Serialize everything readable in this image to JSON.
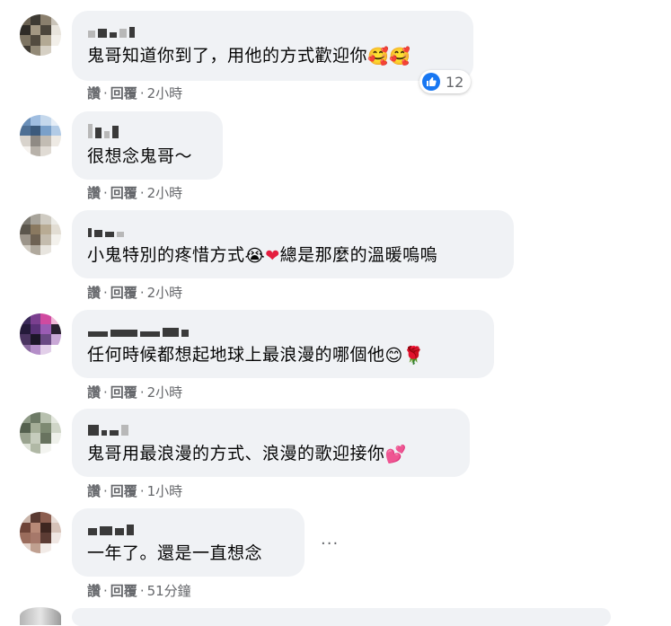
{
  "comments": [
    {
      "text": "鬼哥知道你到了，用他的方式歡迎你",
      "emoji": [
        "smiling-face-with-hearts",
        "smiling-face-with-hearts"
      ],
      "actions": {
        "like": "讚",
        "reply": "回覆",
        "time": "2小時"
      },
      "reaction": {
        "icon": "like-icon",
        "count": "12",
        "color": "#1877f2"
      }
    },
    {
      "text": "很想念鬼哥～",
      "emoji": [],
      "actions": {
        "like": "讚",
        "reply": "回覆",
        "time": "2小時"
      }
    },
    {
      "text": "小鬼特別的疼惜方式",
      "emoji": [
        "loudly-crying-face",
        "red-heart"
      ],
      "text_after": "總是那麼的溫暖嗚嗚",
      "actions": {
        "like": "讚",
        "reply": "回覆",
        "time": "2小時"
      }
    },
    {
      "text": "任何時候都想起地球上最浪漫的哪個他",
      "emoji": [
        "smiling-face",
        "rose"
      ],
      "actions": {
        "like": "讚",
        "reply": "回覆",
        "time": "2小時"
      }
    },
    {
      "text": "鬼哥用最浪漫的方式、浪漫的歌迎接你",
      "emoji": [
        "two-hearts"
      ],
      "actions": {
        "like": "讚",
        "reply": "回覆",
        "time": "1小時"
      }
    },
    {
      "text": "一年了。還是一直想念",
      "emoji": [],
      "actions": {
        "like": "讚",
        "reply": "回覆",
        "time": "51分鐘"
      },
      "more": "···"
    }
  ],
  "dot": "·",
  "colors": {
    "bubble": "#f0f2f5",
    "meta_text": "#65676b",
    "accent": "#1877f2"
  }
}
